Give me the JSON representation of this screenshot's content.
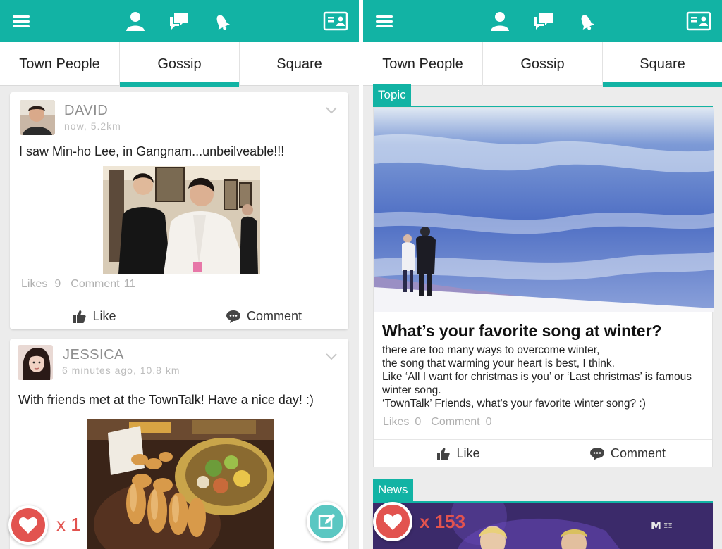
{
  "colors": {
    "accent": "#12b3a4",
    "heart": "#e2534f",
    "write": "#5ac7c2"
  },
  "header_icons": [
    "menu-icon",
    "person-icon",
    "chat-icon",
    "bell-icon",
    "id-card-icon"
  ],
  "left": {
    "tabs": [
      {
        "label": "Town People",
        "active": false
      },
      {
        "label": "Gossip",
        "active": true
      },
      {
        "label": "Square",
        "active": false
      }
    ],
    "posts": [
      {
        "user": "DAVID",
        "meta": "now, 5.2km",
        "text": "I saw Min-ho Lee, in Gangnam...unbeilveable!!!",
        "likes_label": "Likes",
        "likes": "9",
        "comments_label": "Comment",
        "comments": "11",
        "like_label": "Like",
        "comment_label": "Comment"
      },
      {
        "user": "JESSICA",
        "meta": "6 minutes ago, 10.8 km",
        "text": "With friends met at the TownTalk! Have a nice day! :)"
      }
    ],
    "heart_count": "x 1"
  },
  "right": {
    "tabs": [
      {
        "label": "Town People",
        "active": false
      },
      {
        "label": "Gossip",
        "active": false
      },
      {
        "label": "Square",
        "active": true
      }
    ],
    "topic": {
      "tag": "Topic",
      "title": "What’s your favorite song at winter?",
      "body": [
        "there are too many ways to overcome winter,",
        "the song that warming your heart is best, I think.",
        "Like ‘All I want for christmas is you’ or ‘Last christmas’ is famous",
        "winter song.",
        "‘TownTalk’ Friends, what’s your favorite winter song? :)"
      ],
      "likes_label": "Likes",
      "likes": "0",
      "comments_label": "Comment",
      "comments": "0",
      "like_label": "Like",
      "comment_label": "Comment"
    },
    "news": {
      "tag": "News"
    },
    "heart_count": "x 153"
  }
}
